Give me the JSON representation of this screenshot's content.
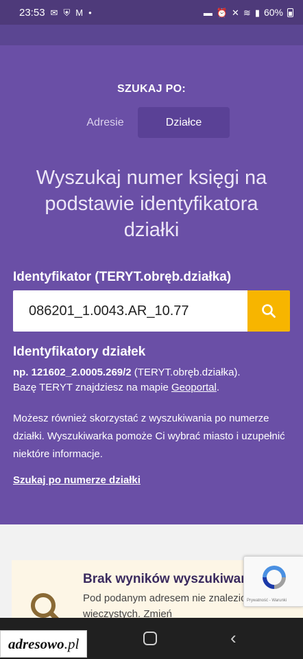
{
  "status_bar": {
    "time": "23:53",
    "left_icons": [
      "mail-icon",
      "shield-icon",
      "gmail-icon",
      "dot-icon"
    ],
    "right_icons": [
      "bed-icon",
      "alarm-icon",
      "mute-icon",
      "wifi-icon",
      "signal-icon"
    ],
    "battery": "60%"
  },
  "search": {
    "section_label": "SZUKAJ PO:",
    "tabs": [
      {
        "label": "Adresie",
        "active": false
      },
      {
        "label": "Działce",
        "active": true
      }
    ],
    "headline": "Wyszukaj numer księgi na podstawie identyfikatora działki",
    "field_label": "Identyfikator (TERYT.obręb.działka)",
    "field_value": "086201_1.0043.AR_10.77",
    "search_button_icon": "search-icon"
  },
  "identifiers": {
    "title": "Identyfikatory działek",
    "example_bold": "np. 121602_2.0005.269/2",
    "example_suffix": " (TERYT.obręb.działka).",
    "teryt_prefix": "Bazę TERYT znajdziesz na mapie ",
    "geoportal_link": "Geoportal",
    "teryt_suffix": ".",
    "more_info": "Możesz również skorzystać z wyszukiwania po numerze działki. Wyszukiwarka pomoże Ci wybrać miasto i uzupełnić niektóre informacje.",
    "search_by_number_link": "Szukaj po numerze działki"
  },
  "no_results": {
    "title": "Brak wyników wyszukiwania",
    "text": "Pod podanym adresem nie znaleziono ksiąg wieczystych. Zmień"
  },
  "recaptcha": {
    "links": "Prywatność - Warunki"
  },
  "nav": {
    "brand_main": "adresowo",
    "brand_suffix": ".pl"
  },
  "colors": {
    "purple": "#6a4fa6",
    "purple_dark": "#5a4196",
    "accent_yellow": "#f7b500",
    "cream": "#fdf6e6"
  }
}
